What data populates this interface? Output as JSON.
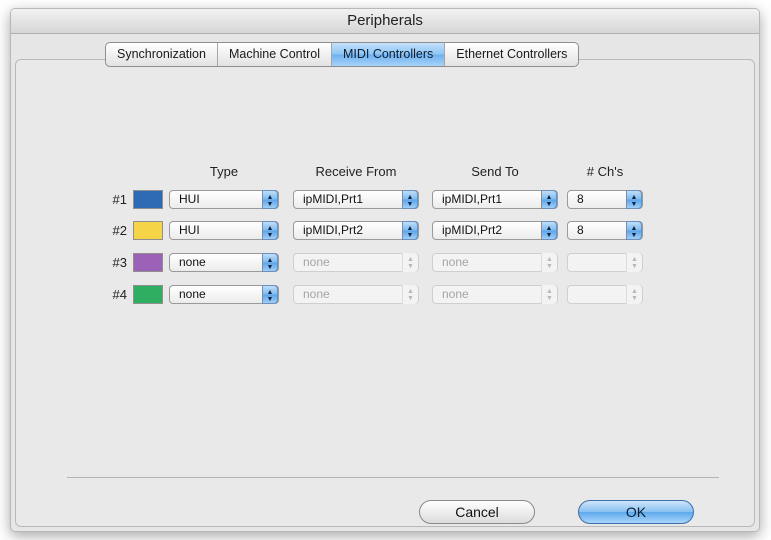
{
  "window": {
    "title": "Peripherals"
  },
  "tabs": [
    {
      "label": "Synchronization",
      "active": false
    },
    {
      "label": "Machine Control",
      "active": false
    },
    {
      "label": "MIDI Controllers",
      "active": true
    },
    {
      "label": "Ethernet Controllers",
      "active": false
    }
  ],
  "columns": {
    "type": "Type",
    "receive_from": "Receive From",
    "send_to": "Send To",
    "channels": "# Ch's"
  },
  "rows": [
    {
      "label": "#1",
      "color": "#2f6bb5",
      "type": "HUI",
      "receive_from": "ipMIDI,Prt1",
      "send_to": "ipMIDI,Prt1",
      "channels": "8",
      "enabled": true
    },
    {
      "label": "#2",
      "color": "#f5d547",
      "type": "HUI",
      "receive_from": "ipMIDI,Prt2",
      "send_to": "ipMIDI,Prt2",
      "channels": "8",
      "enabled": true
    },
    {
      "label": "#3",
      "color": "#9b62b7",
      "type": "none",
      "receive_from": "none",
      "send_to": "none",
      "channels": "",
      "enabled": false
    },
    {
      "label": "#4",
      "color": "#2fae62",
      "type": "none",
      "receive_from": "none",
      "send_to": "none",
      "channels": "",
      "enabled": false
    }
  ],
  "buttons": {
    "cancel": "Cancel",
    "ok": "OK"
  },
  "icons": {
    "popup_arrow": "up-down-arrows-icon"
  }
}
